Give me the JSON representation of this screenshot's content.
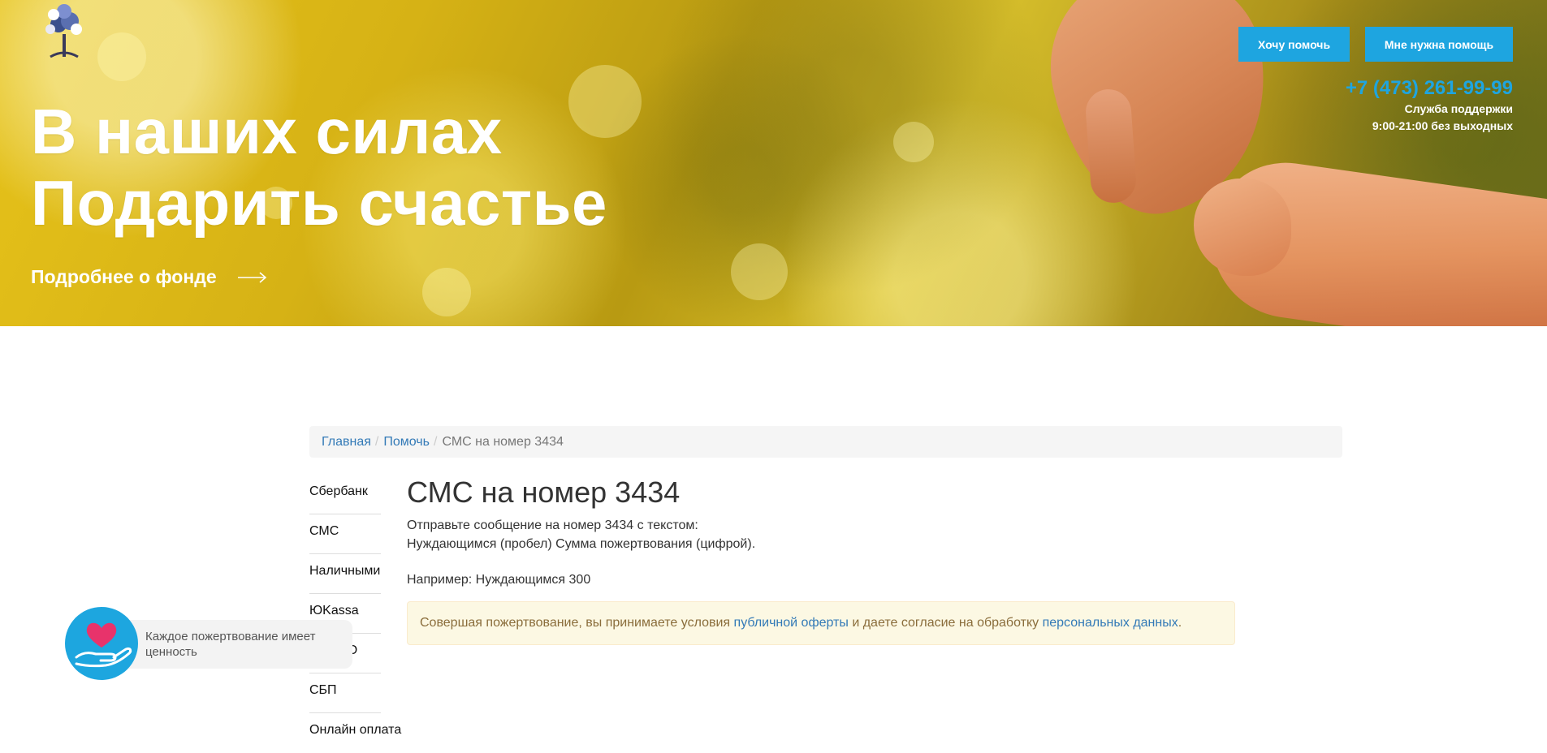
{
  "header": {
    "headline_line1": "В наших силах",
    "headline_line2": "Подарить счастье",
    "about_link": "Подробнее о фонде",
    "buttons": {
      "help": "Хочу помочь",
      "need_help": "Мне нужна помощь"
    },
    "phone": "+7 (473) 261-99-99",
    "support_label": "Служба поддержки",
    "support_hours": "9:00-21:00 без выходных"
  },
  "breadcrumb": {
    "home": "Главная",
    "help": "Помочь",
    "current": "СМС на номер 3434",
    "separator": "/"
  },
  "side_nav": {
    "items": [
      {
        "label": "Сбербанк"
      },
      {
        "label": "СМС"
      },
      {
        "label": "Наличными"
      },
      {
        "label": "ЮKassa"
      },
      {
        "label": "ВТБ ОО"
      },
      {
        "label": "СБП"
      },
      {
        "label": "Онлайн оплата"
      }
    ]
  },
  "main": {
    "title": "СМС на номер 3434",
    "instruction_line1": "Отправьте сообщение на номер 3434 с текстом:",
    "instruction_line2": "Нуждающимся (пробел) Сумма пожертвования (цифрой).",
    "example": "Например: Нуждающимся 300",
    "alert": {
      "text_before": "Совершая пожертвование, вы принимаете условия ",
      "link_offer": "публичной оферты",
      "text_middle": " и даете согласие на обработку ",
      "link_personal": "персональных данных",
      "text_after": "."
    }
  },
  "widget": {
    "text": "Каждое пожертвование имеет ценность"
  },
  "colors": {
    "accent": "#1ea5e0",
    "link": "#337ab7",
    "alert_bg": "#fcf8e3",
    "alert_text": "#8a6d3b",
    "heart": "#e8336b"
  },
  "icons": {
    "arrow": "arrow-right-icon",
    "logo": "tree-logo-icon",
    "widget": "heart-hand-icon"
  }
}
